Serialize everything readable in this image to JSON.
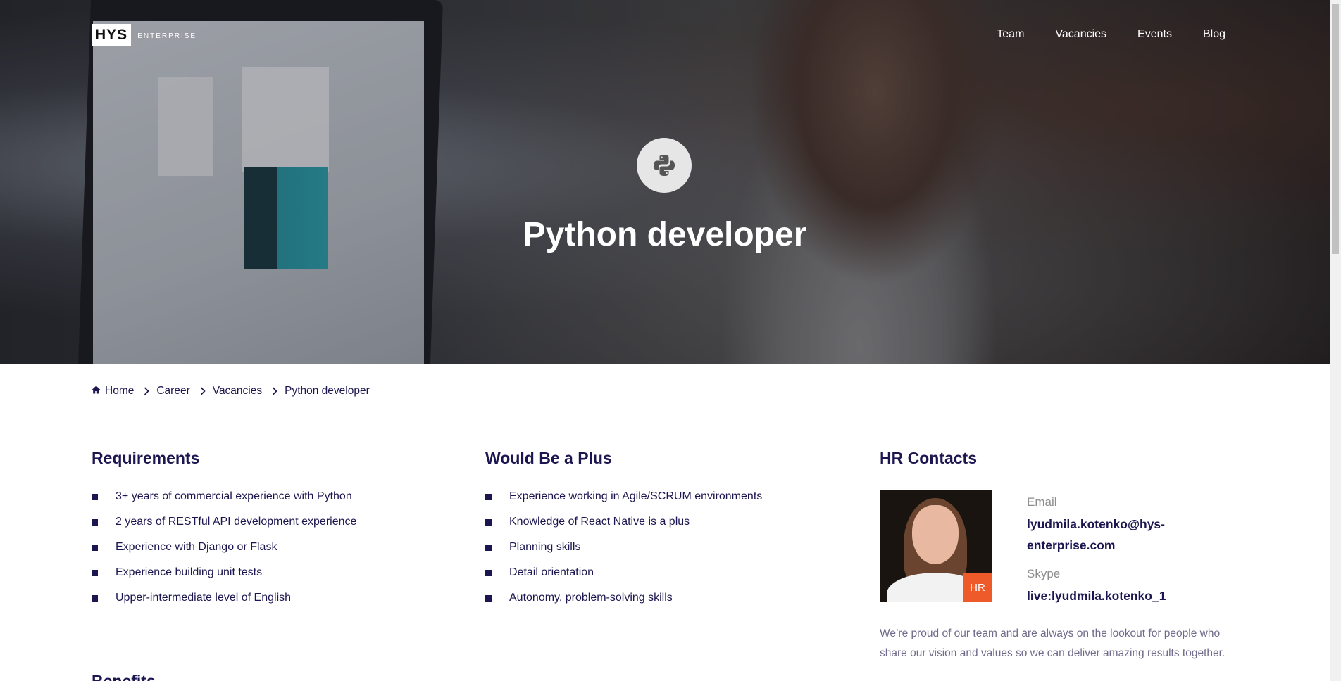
{
  "header": {
    "logo_main": "HYS",
    "logo_sub": "ENTERPRISE",
    "nav": [
      "Team",
      "Vacancies",
      "Events",
      "Blog"
    ]
  },
  "hero": {
    "icon": "python-icon",
    "title": "Python developer"
  },
  "breadcrumb": {
    "items": [
      "Home",
      "Career",
      "Vacancies",
      "Python developer"
    ]
  },
  "requirements": {
    "title": "Requirements",
    "items": [
      "3+ years of commercial experience with Python",
      "2 years of RESTful API development experience",
      "Experience with Django or Flask",
      "Experience building unit tests",
      "Upper-intermediate level of English"
    ]
  },
  "plus": {
    "title": "Would Be a Plus",
    "items": [
      "Experience working in Agile/SCRUM environments",
      "Knowledge of React Native is a plus",
      "Planning skills",
      "Detail orientation",
      "Autonomy, problem-solving skills"
    ]
  },
  "hr": {
    "title": "HR Contacts",
    "badge": "HR",
    "email_label": "Email",
    "email": "lyudmila.kotenko@hys-enterprise.com",
    "skype_label": "Skype",
    "skype": "live:lyudmila.kotenko_1",
    "note": "We’re proud of our team and are always on the lookout for people who share our vision and values so we can deliver amazing results together."
  },
  "benefits": {
    "title": "Benefits"
  },
  "colors": {
    "accent": "#1c1650",
    "badge": "#ef5a2b"
  }
}
